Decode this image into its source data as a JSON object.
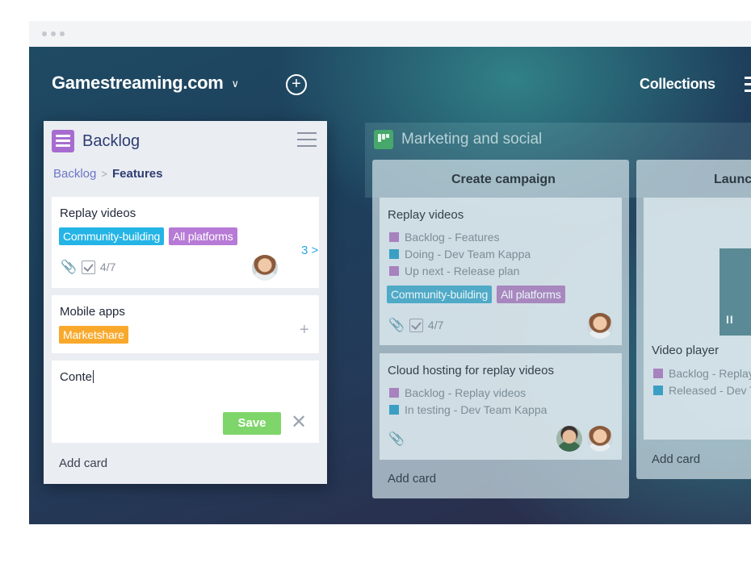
{
  "header": {
    "workspace_name": "Gamestreaming.com",
    "collections_label": "Collections"
  },
  "backlog": {
    "title": "Backlog",
    "breadcrumb": {
      "parent": "Backlog",
      "current": "Features"
    },
    "cards": [
      {
        "title": "Replay videos",
        "tags": [
          "Community-building",
          "All platforms"
        ],
        "checklist": "4/7",
        "counter": "3 >"
      },
      {
        "title": "Mobile apps",
        "tags": [
          "Marketshare"
        ]
      }
    ],
    "new_card": {
      "input_value": "Conte",
      "save_label": "Save"
    },
    "add_card_label": "Add card"
  },
  "board": {
    "title": "Marketing and social",
    "columns": [
      {
        "title": "Create campaign",
        "cards": [
          {
            "title": "Replay videos",
            "links": [
              "Backlog - Features",
              "Doing - Dev Team Kappa",
              "Up next - Release plan"
            ],
            "tags": [
              "Community-building",
              "All platforms"
            ],
            "checklist": "4/7"
          },
          {
            "title": "Cloud hosting for replay videos",
            "links": [
              "Backlog - Replay videos",
              "In testing - Dev Team Kappa"
            ]
          }
        ],
        "add_card_label": "Add card"
      },
      {
        "title": "Launch",
        "cards": [
          {
            "title": "Video player",
            "links": [
              "Backlog - Replay",
              "Released - Dev T"
            ]
          }
        ],
        "add_card_label": "Add card"
      }
    ]
  },
  "colors": {
    "tag_teal": "#25b4e6",
    "tag_purple": "#b77ad6",
    "tag_orange": "#f8a92c",
    "save_green": "#7ed66a",
    "backlog_icon": "#a86cd0",
    "board_icon": "#46a86a"
  },
  "icons": [
    "chevron-down-icon",
    "add-circle-icon",
    "menu-icon",
    "list-icon",
    "hamburger-icon",
    "paperclip-icon",
    "checklist-icon",
    "chevron-right-icon",
    "plus-icon",
    "close-icon",
    "board-icon",
    "pause-icon"
  ]
}
